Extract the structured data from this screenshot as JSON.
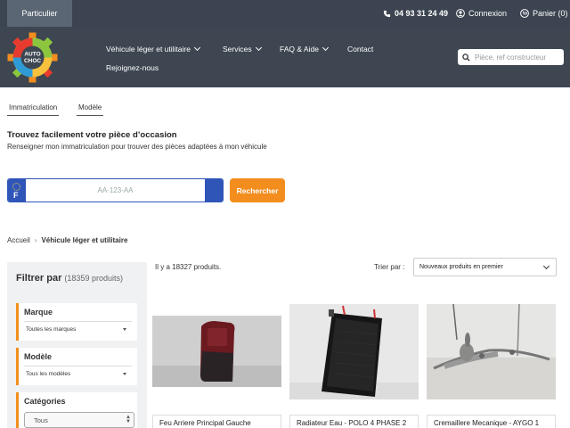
{
  "topbar": {
    "tab_label": "Particulier",
    "phone": "04 93 31 24 49",
    "login": "Connexion",
    "cart": "Panier (0)"
  },
  "header": {
    "logo_text_line1": "AUTO",
    "logo_text_line2": "CHOC",
    "nav": [
      {
        "label": "Véhicule léger et utilitaire"
      },
      {
        "label": "Services"
      },
      {
        "label": "FAQ & Aide"
      },
      {
        "label": "Contact"
      },
      {
        "label": "Rejoignez-nous"
      }
    ],
    "search_placeholder": "Pièce, ref constructeur"
  },
  "search_tabs": [
    "Immatriculation",
    "Modèle"
  ],
  "finder": {
    "title": "Trouvez facilement votre pièce d’occasion",
    "description": "Renseigner mon immatriculation pour trouver des pièces adaptées à mon véhicule",
    "plate_country": "F",
    "plate_placeholder": "AA-123-AA",
    "button": "Rechercher"
  },
  "breadcrumb": {
    "home": "Accueil",
    "separator": "›",
    "current": "Véhicule léger et utilitaire"
  },
  "filters": {
    "title": "Filtrer par",
    "count": "(18359 produits)",
    "marque_label": "Marque",
    "marque_value": "Toutes les marques",
    "modele_label": "Modèle",
    "modele_value": "Tous les modèles",
    "categories_label": "Catégories",
    "categories_value": "Tous"
  },
  "listing": {
    "count_text": "Il y a 18327 produits.",
    "sort_label": "Trier par :",
    "sort_value": "Nouveaux produits en premier"
  },
  "products": [
    {
      "name": "Feu Arriere Principal Gauche"
    },
    {
      "name": "Radiateur Eau - POLO 4 PHASE 2"
    },
    {
      "name": "Cremaillere Mecanique - AYGO 1"
    }
  ],
  "colors": {
    "topbar": "#3b4450",
    "header": "#3d4651",
    "accent": "#f28d1e",
    "plate_blue": "#2f55b8"
  }
}
